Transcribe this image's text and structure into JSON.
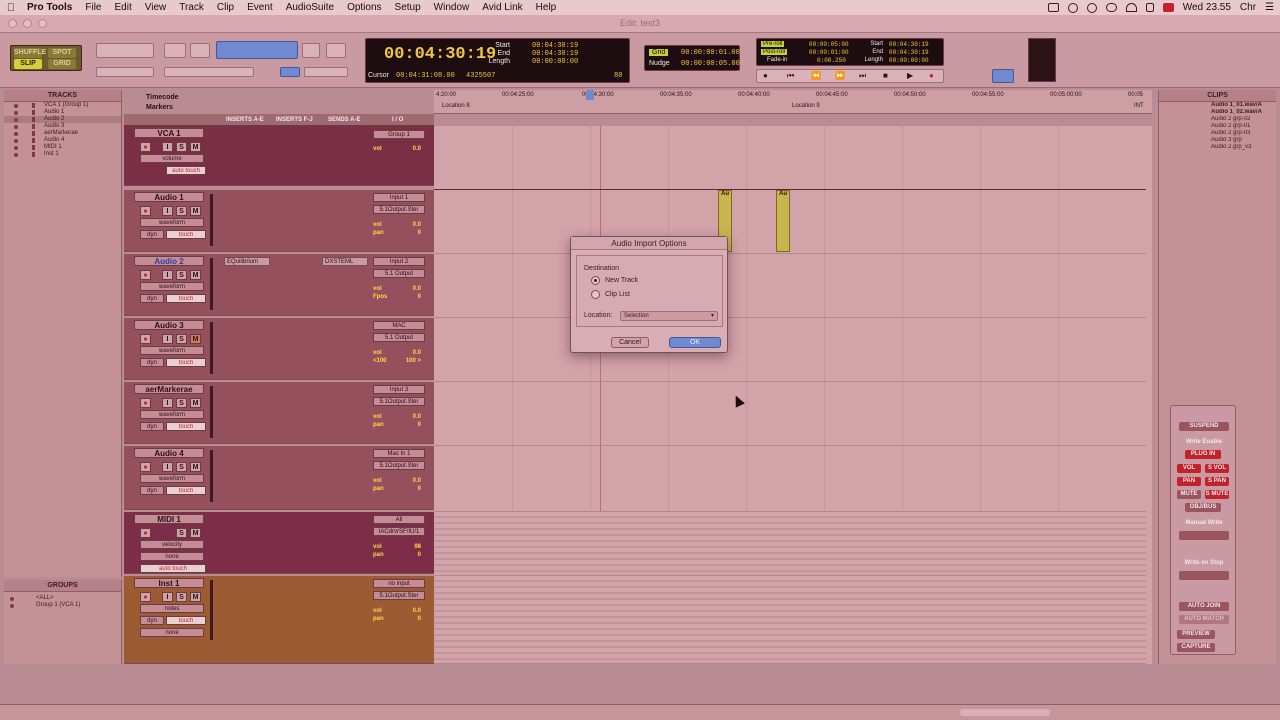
{
  "menubar": {
    "app": "Pro Tools",
    "items": [
      "File",
      "Edit",
      "View",
      "Track",
      "Clip",
      "Event",
      "AudioSuite",
      "Options",
      "Setup",
      "Window",
      "Avid Link",
      "Help"
    ],
    "clock": "Wed 23.55",
    "user": "Chr"
  },
  "window": {
    "title": "Edit: test3"
  },
  "toolbar": {
    "modes": [
      "SHUFFLE",
      "SPOT",
      "SLIP",
      "GRID"
    ],
    "main_counter": "00:04:30:19",
    "cursor_label": "Cursor",
    "cursor_value": "00:04:31:08.00",
    "sample_value": "4325507",
    "start_label": "Start",
    "end_label": "End",
    "length_label": "Length",
    "start_value": "00:04:30:19",
    "end_value": "00:04:30:19",
    "length_value": "00:00:00:00",
    "grid_label": "Grid",
    "grid_value": "00:00:00:01.00",
    "nudge_label": "Nudge",
    "nudge_value": "00:00:00:05.00",
    "preroll_label": "Pre-roll",
    "postroll_label": "Post-roll",
    "fadein_label": "Fade-in",
    "preroll_value": "00:00:05:00",
    "postroll_value": "00:00:01:00",
    "fadein_value": "0:00.250",
    "start2_value": "00:04:30:19",
    "end2_value": "00:04:30:19",
    "length2_value": "00:00:00:00",
    "bpm": "80"
  },
  "tracks_panel": {
    "header": "TRACKS",
    "items": [
      "VCA 1 (Group 1)",
      "Audio 1",
      "Audio 2",
      "Audio 3",
      "aerMarkerae",
      "Audio 4",
      "MIDI 1",
      "Inst 1"
    ]
  },
  "groups_panel": {
    "header": "GROUPS",
    "items": [
      "<ALL>",
      "Group 1 (VCA 1)"
    ]
  },
  "columns": {
    "inserts_ae": "INSERTS A-E",
    "inserts_fj": "INSERTS F-J",
    "sends_ae": "SENDS A-E",
    "io": "I / O"
  },
  "rulers": {
    "timecode": "Timecode",
    "markers": "Markers",
    "ticks": [
      "4:20:00",
      "00:04:25:00",
      "00:04:30:00",
      "00:04:35:00",
      "00:04:40:00",
      "00:04:45:00",
      "00:04:50:00",
      "00:04:55:00",
      "00:05:00:00",
      "00:05"
    ],
    "marker_loc8": "Location 8",
    "marker_loc9": "Location 9",
    "marker_int": "INT"
  },
  "tracks": [
    {
      "name": "VCA 1",
      "mode": "volume",
      "auto": "auto touch",
      "io1": "Group 1",
      "vol_label": "vol",
      "vol": "0.0"
    },
    {
      "name": "Audio 1",
      "mode": "waveform",
      "dyn": "dyn",
      "auto": "touch",
      "io1": "Input 1",
      "io2": "5.1Output.Ster",
      "vol_label": "vol",
      "vol": "0.0",
      "pan_label": "pan",
      "pan": "0"
    },
    {
      "name": "Audio 2",
      "mode": "waveform",
      "dyn": "dyn",
      "auto": "touch",
      "insert": "EQuilibrium",
      "send": "DXSTEML",
      "io1": "Input 2",
      "io2": "5.1 Output",
      "vol_label": "vol",
      "vol": "0.0",
      "pan_label": "Fpos",
      "pan": "0"
    },
    {
      "name": "Audio 3",
      "mode": "waveform",
      "dyn": "dyn",
      "auto": "touch",
      "io1": "MAC",
      "io2": "5.1 Output",
      "vol_label": "vol",
      "vol": "0.0",
      "pan_label": "<100",
      "pan": "100 >"
    },
    {
      "name": "aerMarkerae",
      "mode": "waveform",
      "dyn": "dyn",
      "auto": "touch",
      "io1": "Input 3",
      "io2": "5.1Output.Ster",
      "vol_label": "vol",
      "vol": "0.0",
      "pan_label": "pan",
      "pan": "0"
    },
    {
      "name": "Audio 4",
      "mode": "waveform",
      "dyn": "dyn",
      "auto": "touch",
      "io1": "Mac In 1",
      "io2": "5.1Output.Ster",
      "vol_label": "vol",
      "vol": "0.0",
      "pan_label": "pan",
      "pan": "0"
    },
    {
      "name": "MIDI 1",
      "mode": "velocity",
      "sub": "none",
      "auto": "auto touch",
      "io1": "All",
      "io2": "IACdrvrSF/IU/1",
      "vol_label": "vol",
      "vol": "98",
      "pan_label": "pan",
      "pan": "0"
    },
    {
      "name": "Inst 1",
      "mode": "notes",
      "dyn": "dyn",
      "auto": "touch",
      "sub": "none",
      "io1": "no input",
      "io2": "5.1Output.Ster",
      "vol_label": "vol",
      "vol": "0.0",
      "pan_label": "pan",
      "pan": "0"
    }
  ],
  "clips_panel": {
    "header": "CLIPS",
    "items": [
      "Audio 1_01.wav/A",
      "Audio 1_02.wav/A",
      "Audio 2 grp-02",
      "Audio 2 grp-01",
      "Audio 2 grp-03",
      "Audio 3 grp",
      "Audio 2.grp_v3"
    ]
  },
  "clip_label": "Au",
  "automation": {
    "suspend": "SUSPEND",
    "write_enable": "Write Enable",
    "plugin": "PLUG IN",
    "vol": "VOL",
    "svol": "S VOL",
    "pan": "PAN",
    "span": "S PAN",
    "mute": "MUTE",
    "smute": "S MUTE",
    "objbus": "OBJ/BUS",
    "manual_write": "Manual Write",
    "write_on_stop": "Write on Stop",
    "auto_join": "AUTO JOIN",
    "auto_match": "AUTO MATCH",
    "preview": "PREVIEW",
    "capture": "CAPTURE"
  },
  "dialog": {
    "title": "Audio Import Options",
    "destination": "Destination",
    "new_track": "New Track",
    "clip_list": "Clip List",
    "location_label": "Location:",
    "location_value": "Selection",
    "cancel": "Cancel",
    "ok": "OK"
  },
  "colors": {
    "accent": "#6f8ad0",
    "record": "#c2222c",
    "lcd": "#f1c640",
    "clip": "#c7b54d"
  }
}
